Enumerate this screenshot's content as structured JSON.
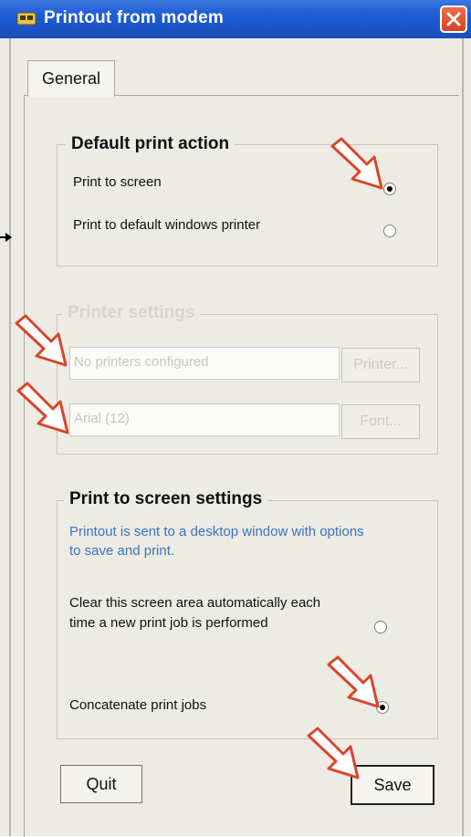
{
  "window": {
    "title": "Printout from modem"
  },
  "tabs": [
    {
      "label": "General"
    }
  ],
  "default_print_action": {
    "title": "Default print action",
    "options": [
      {
        "label": "Print to screen",
        "selected": true
      },
      {
        "label": "Print to default windows printer",
        "selected": false
      }
    ]
  },
  "printer_settings": {
    "title": "Printer settings",
    "printer_field": "No printers configured",
    "printer_button": "Printer...",
    "font_field": "Arial (12)",
    "font_button": "Font..."
  },
  "screen_settings": {
    "title": "Print to screen settings",
    "info": "Printout is sent to a desktop window with options to save and print.",
    "options": [
      {
        "label": "Clear this screen area automatically each time a new print job is performed",
        "selected": false
      },
      {
        "label": "Concatenate print jobs",
        "selected": true
      }
    ]
  },
  "buttons": {
    "quit": "Quit",
    "save": "Save"
  },
  "colors": {
    "titlebar": "#1f5fd6",
    "annotation_arrow": "#d9452b",
    "info_text": "#3b73bf"
  }
}
